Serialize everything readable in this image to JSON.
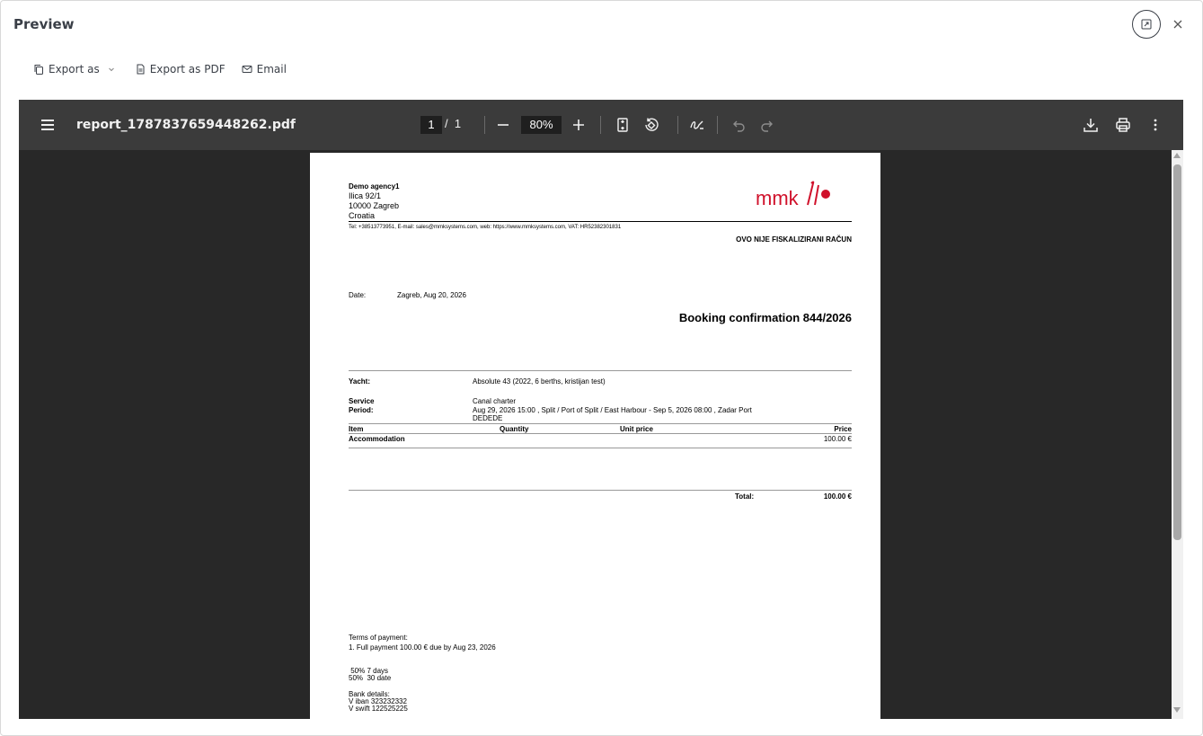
{
  "modal": {
    "title": "Preview",
    "actions": {
      "export_as": "Export as",
      "export_pdf": "Export as PDF",
      "email": "Email"
    }
  },
  "viewer": {
    "filename": "report_1787837659448262.pdf",
    "current_page": "1",
    "page_separator": "/",
    "total_pages": "1",
    "zoom": "80%"
  },
  "document": {
    "company_name": "Demo agency1",
    "address_line1": "Ilica 92/1",
    "address_line2": "10000 Zagreb",
    "country": "Croatia",
    "contact_line": "Tel: +38513773951, E-mail: sales@mmksystems.com, web: https://www.mmksystems.com, VAT: HR52382301831",
    "logo_text": "mmk",
    "fiscal_notice": "OVO NIJE FISKALIZIRANI RAČUN",
    "date_label": "Date:",
    "date_value": "Zagreb, Aug 20, 2026",
    "heading": "Booking confirmation 844/2026",
    "yacht_label": "Yacht:",
    "yacht_value": "Absolute 43 (2022, 6 berths, kristijan test)",
    "service_label": "Service",
    "service_value": "Canal charter",
    "period_label": "Period:",
    "period_value": "Aug 29, 2026 15:00 , Split / Port of Split / East Harbour - Sep 5, 2026 08:00 , Zadar Port",
    "period_note": "DEDEDE",
    "table": {
      "headers": [
        "Item",
        "Quantity",
        "Unit price",
        "Price"
      ],
      "rows": [
        {
          "item": "Accommodation",
          "quantity": "",
          "unit_price": "",
          "price": "100.00 €"
        }
      ]
    },
    "total_label": "Total:",
    "total_value": "100.00 €",
    "terms_title": "Terms of payment:",
    "terms_line": "1. Full payment 100.00 € due by Aug 23, 2026",
    "note_line1": " 50% 7 days",
    "note_line2": "50%  30 date",
    "bank_title": "Bank details:",
    "bank_iban": "V iban 323232332",
    "bank_swift": "V swift 122525225"
  },
  "colors": {
    "viewer_bg": "#282828",
    "viewer_toolbar": "#3b3b3b",
    "logo_red": "#d0112b"
  },
  "icons": {
    "expand": "expand-icon",
    "close": "close-icon",
    "export_as": "copy-icon",
    "export_pdf": "pdf-icon",
    "email": "mail-icon",
    "menu": "menu-icon",
    "zoom_out": "minus-icon",
    "zoom_in": "plus-icon",
    "fit": "fit-page-icon",
    "rotate": "rotate-icon",
    "draw": "draw-icon",
    "undo": "undo-icon",
    "redo": "redo-icon",
    "download": "download-icon",
    "print": "print-icon",
    "more": "more-vertical-icon"
  }
}
